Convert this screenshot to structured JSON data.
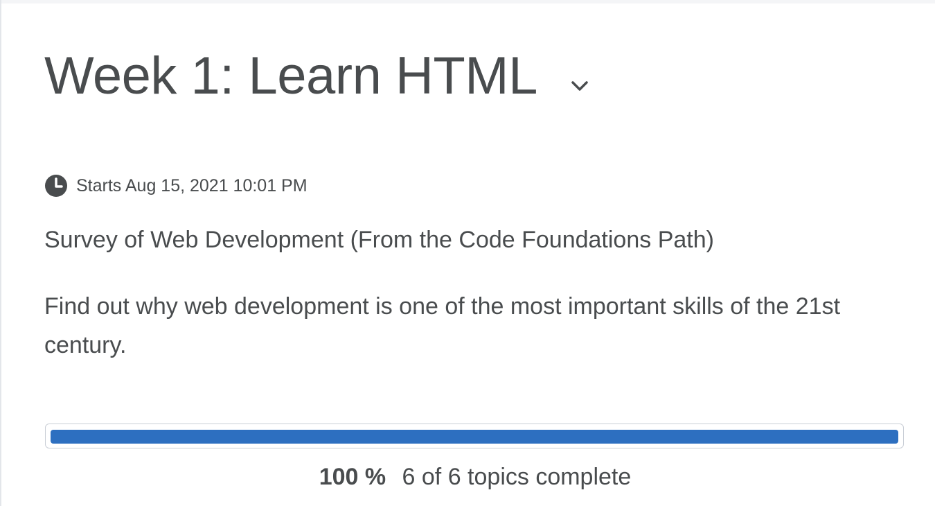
{
  "module": {
    "title": "Week 1: Learn HTML",
    "chevron_icon": "chevron-down-icon",
    "start": {
      "icon": "clock-icon",
      "text": "Starts Aug 15, 2021 10:01 PM"
    },
    "subtitle": "Survey of Web Development (From the Code Foundations Path)",
    "description": "Find out why web development is one of the most important skills of the 21st century."
  },
  "progress": {
    "percent_value": 100,
    "percent_label": "100 %",
    "detail": "6 of 6 topics complete",
    "fill_color": "#2d6fc0",
    "track_border_color": "#c9ced6"
  }
}
